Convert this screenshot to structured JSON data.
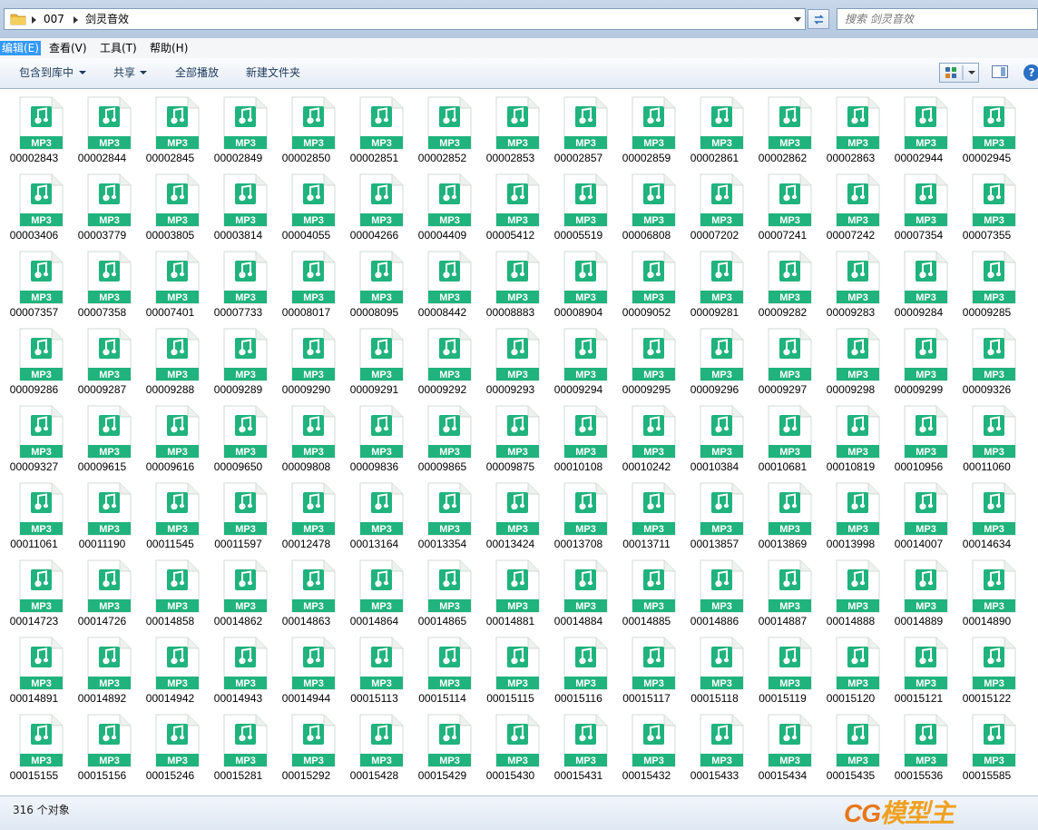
{
  "address": {
    "crumbs": [
      "007",
      "剑灵音效"
    ],
    "search_placeholder": "搜索 剑灵音效"
  },
  "menu": [
    "编辑(E)",
    "查看(V)",
    "工具(T)",
    "帮助(H)"
  ],
  "toolbar": {
    "include_library": "包含到库中",
    "share": "共享",
    "play_all": "全部播放",
    "new_folder": "新建文件夹"
  },
  "colors": {
    "icon_green": "#20b37d",
    "selection_blue": "#3399ff"
  },
  "file_type_badge": "MP3",
  "files": [
    "00002843",
    "00002844",
    "00002845",
    "00002849",
    "00002850",
    "00002851",
    "00002852",
    "00002853",
    "00002857",
    "00002859",
    "00002861",
    "00002862",
    "00002863",
    "00002944",
    "00002945",
    "00003406",
    "00003779",
    "00003805",
    "00003814",
    "00004055",
    "00004266",
    "00004409",
    "00005412",
    "00005519",
    "00006808",
    "00007202",
    "00007241",
    "00007242",
    "00007354",
    "00007355",
    "00007357",
    "00007358",
    "00007401",
    "00007733",
    "00008017",
    "00008095",
    "00008442",
    "00008883",
    "00008904",
    "00009052",
    "00009281",
    "00009282",
    "00009283",
    "00009284",
    "00009285",
    "00009286",
    "00009287",
    "00009288",
    "00009289",
    "00009290",
    "00009291",
    "00009292",
    "00009293",
    "00009294",
    "00009295",
    "00009296",
    "00009297",
    "00009298",
    "00009299",
    "00009326",
    "00009327",
    "00009615",
    "00009616",
    "00009650",
    "00009808",
    "00009836",
    "00009865",
    "00009875",
    "00010108",
    "00010242",
    "00010384",
    "00010681",
    "00010819",
    "00010956",
    "00011060",
    "00011061",
    "00011190",
    "00011545",
    "00011597",
    "00012478",
    "00013164",
    "00013354",
    "00013424",
    "00013708",
    "00013711",
    "00013857",
    "00013869",
    "00013998",
    "00014007",
    "00014634",
    "00014723",
    "00014726",
    "00014858",
    "00014862",
    "00014863",
    "00014864",
    "00014865",
    "00014881",
    "00014884",
    "00014885",
    "00014886",
    "00014887",
    "00014888",
    "00014889",
    "00014890",
    "00014891",
    "00014892",
    "00014942",
    "00014943",
    "00014944",
    "00015113",
    "00015114",
    "00015115",
    "00015116",
    "00015117",
    "00015118",
    "00015119",
    "00015120",
    "00015121",
    "00015122",
    "00015155",
    "00015156",
    "00015246",
    "00015281",
    "00015292",
    "00015428",
    "00015429",
    "00015430",
    "00015431",
    "00015432",
    "00015433",
    "00015434",
    "00015435",
    "00015536",
    "00015585"
  ],
  "status": {
    "count_text": "316 个对象"
  },
  "watermark": {
    "brand": "CG",
    "text": "模型主"
  }
}
